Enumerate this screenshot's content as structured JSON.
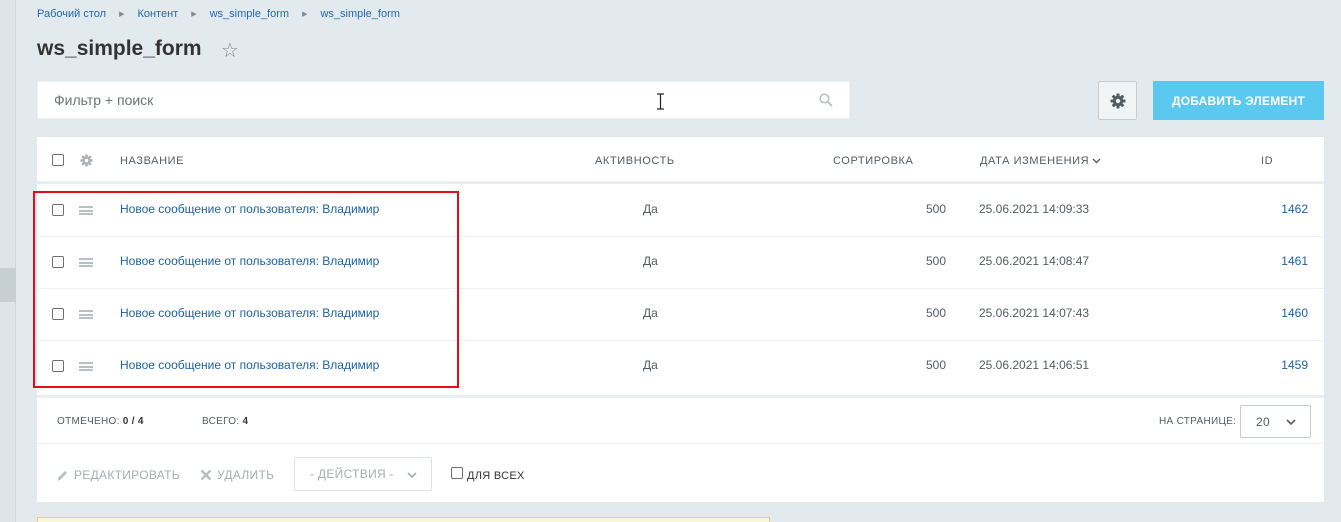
{
  "breadcrumb": [
    "Рабочий стол",
    "Контент",
    "ws_simple_form",
    "ws_simple_form"
  ],
  "page": {
    "title": "ws_simple_form"
  },
  "filter": {
    "placeholder": "Фильтр + поиск"
  },
  "toolbar": {
    "add_label": "ДОБАВИТЬ ЭЛЕМЕНТ"
  },
  "table": {
    "columns": {
      "name": "НАЗВАНИЕ",
      "active": "АКТИВНОСТЬ",
      "sort": "СОРТИРОВКА",
      "date": "ДАТА ИЗМЕНЕНИЯ",
      "id": "ID"
    },
    "rows": [
      {
        "name": "Новое сообщение от пользователя: Владимир",
        "active": "Да",
        "sort": "500",
        "date": "25.06.2021 14:09:33",
        "id": "1462"
      },
      {
        "name": "Новое сообщение от пользователя: Владимир",
        "active": "Да",
        "sort": "500",
        "date": "25.06.2021 14:08:47",
        "id": "1461"
      },
      {
        "name": "Новое сообщение от пользователя: Владимир",
        "active": "Да",
        "sort": "500",
        "date": "25.06.2021 14:07:43",
        "id": "1460"
      },
      {
        "name": "Новое сообщение от пользователя: Владимир",
        "active": "Да",
        "sort": "500",
        "date": "25.06.2021 14:06:51",
        "id": "1459"
      }
    ]
  },
  "footer": {
    "selected_label": "ОТМЕЧЕНО:",
    "selected_value": "0 / 4",
    "total_label": "ВСЕГО:",
    "total_value": "4",
    "perpage_label": "НА СТРАНИЦЕ:",
    "perpage_value": "20"
  },
  "actions": {
    "edit": "РЕДАКТИРОВАТЬ",
    "delete": "УДАЛИТЬ",
    "dropdown": "- ДЕЙСТВИЯ -",
    "for_all": "ДЛЯ ВСЕХ"
  },
  "colors": {
    "accent": "#5bc8ef",
    "link": "#1e62a2",
    "highlight": "#e0101a"
  }
}
